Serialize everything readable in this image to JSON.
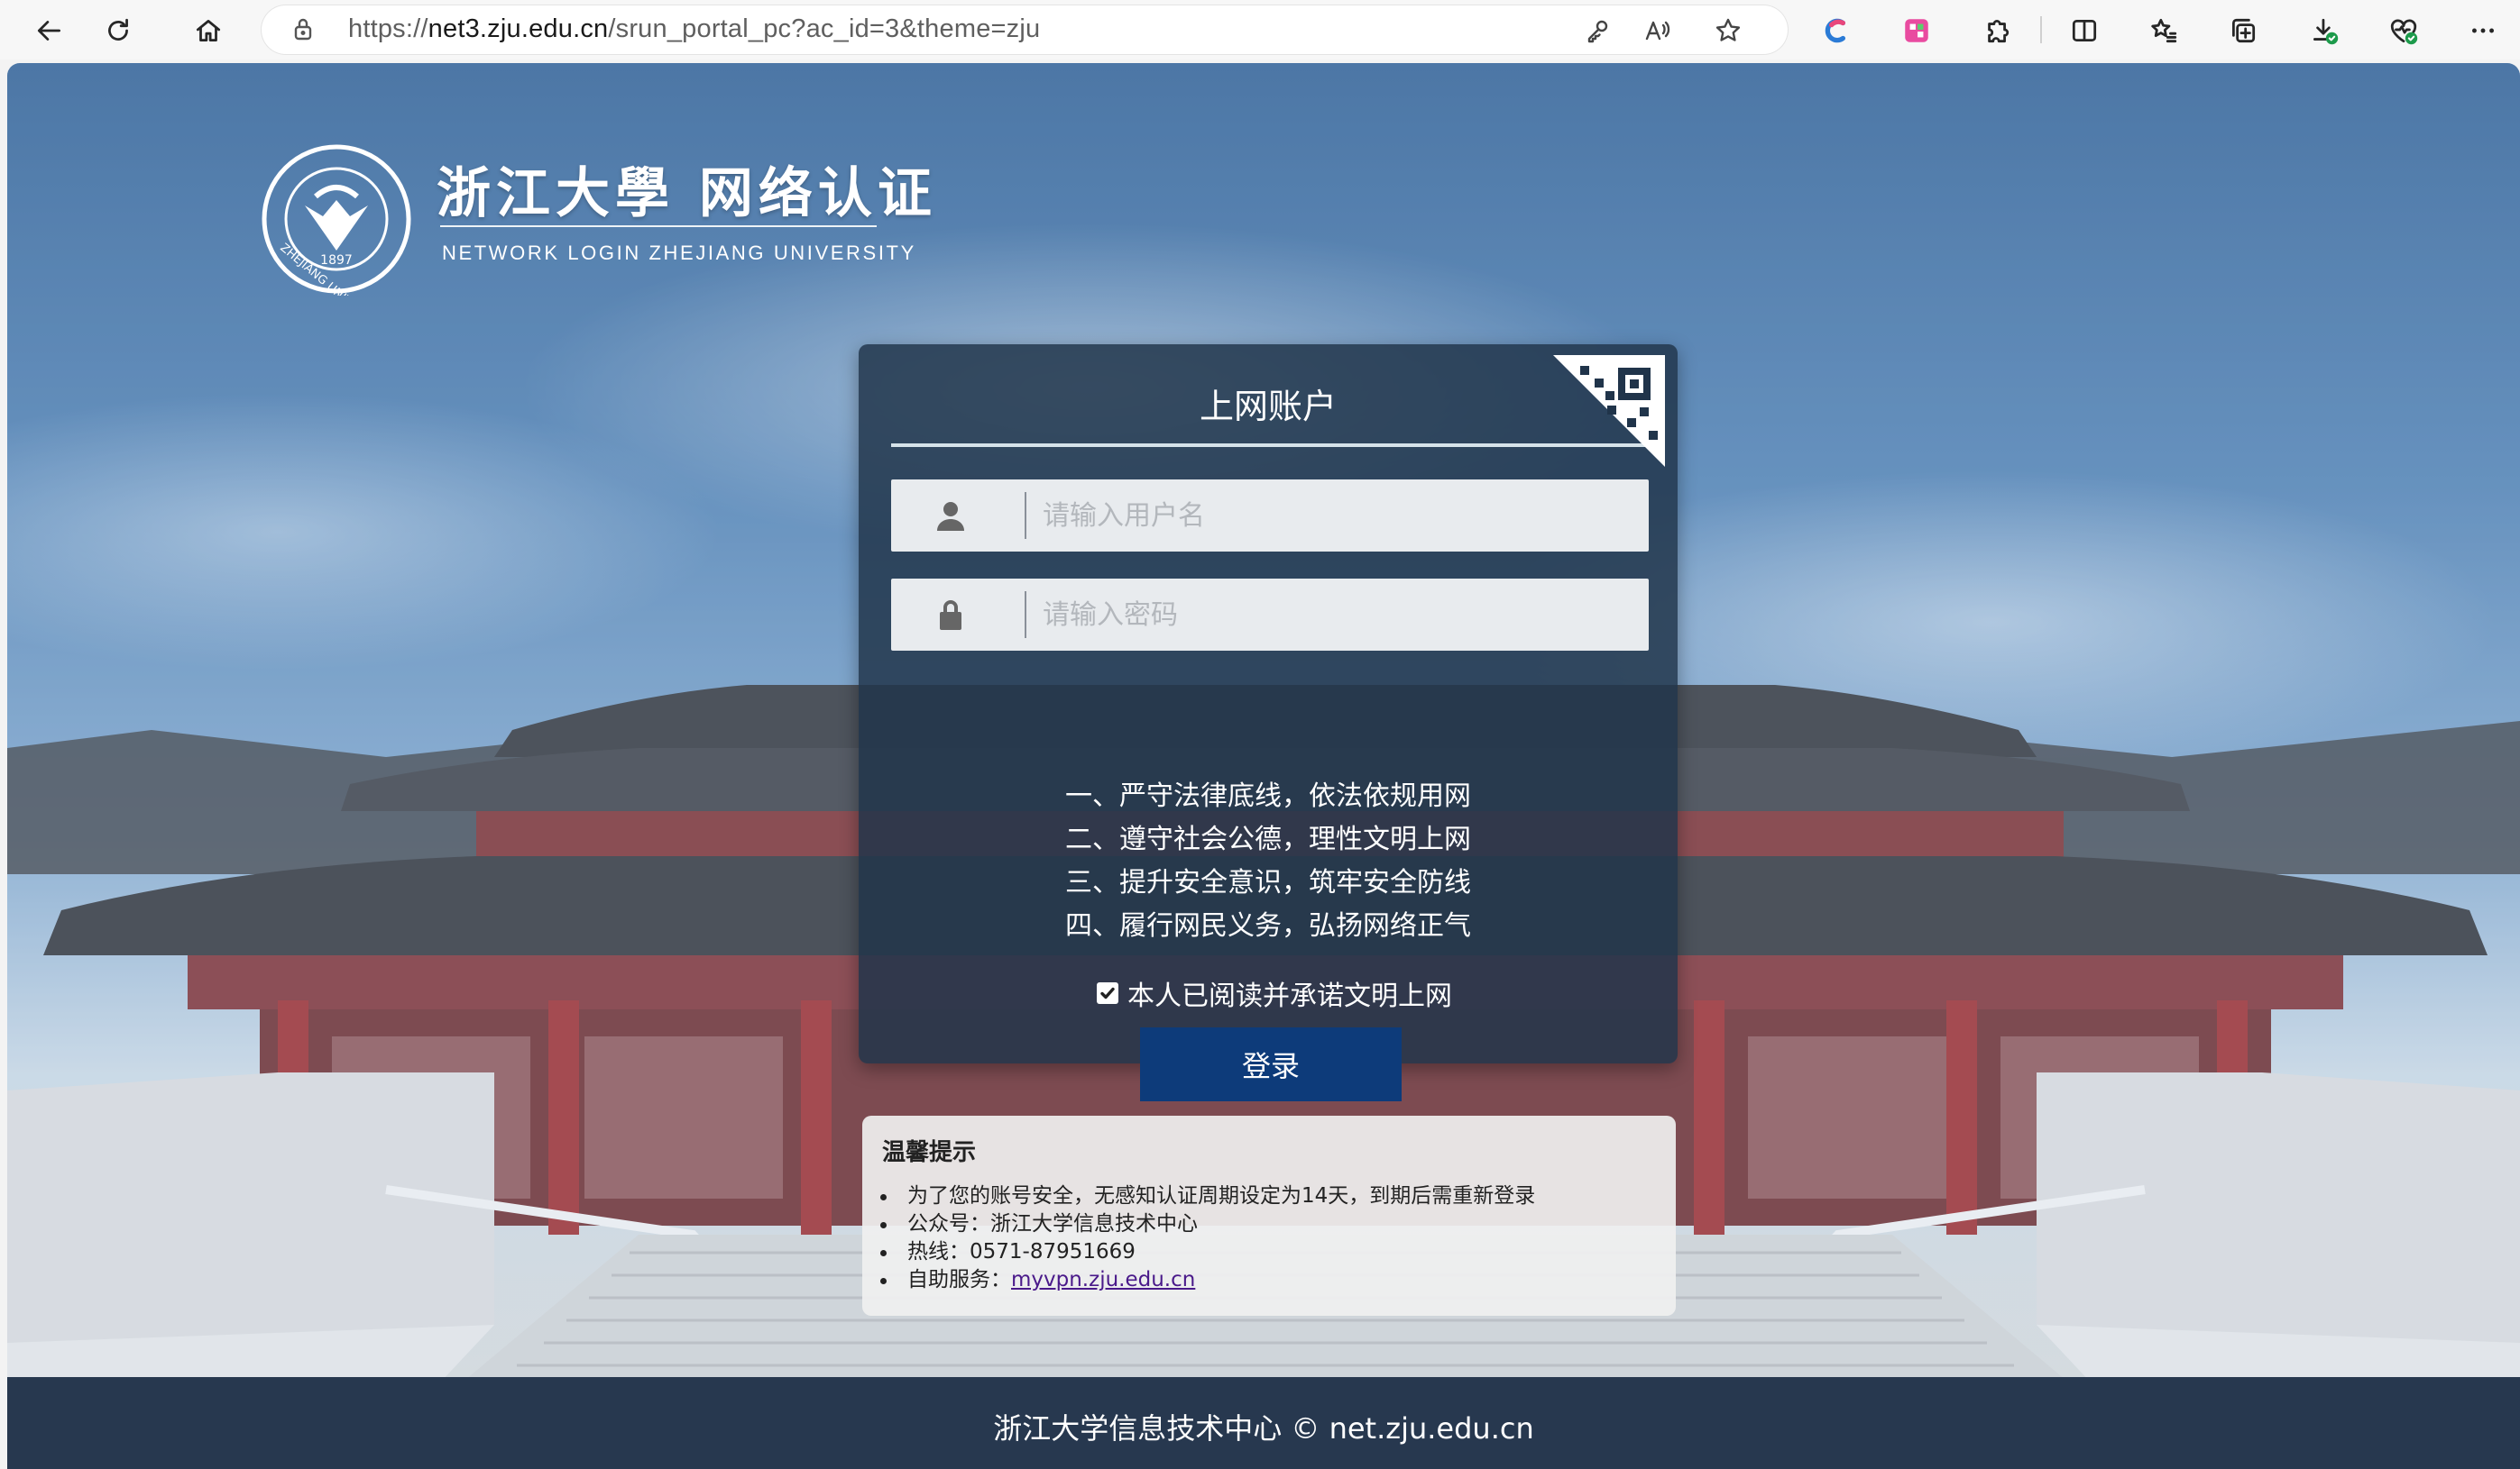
{
  "browser": {
    "url_prefix": "https://",
    "url_host": "net3.zju.edu.cn",
    "url_path": "/srun_portal_pc?ac_id=3&theme=zju",
    "icons": [
      "back-icon",
      "refresh-icon",
      "home-icon",
      "site-info-icon",
      "password-key-icon",
      "read-aloud-icon",
      "favorite-star-icon",
      "copilot-icon",
      "extension-icon",
      "puzzle-icon",
      "split-screen-icon",
      "favorites-icon",
      "collections-icon",
      "downloads-icon",
      "browser-essentials-icon",
      "more-icon"
    ]
  },
  "logo": {
    "title": "浙江大學 网络认证",
    "subtitle": "NETWORK LOGIN ZHEJIANG UNIVERSITY"
  },
  "login": {
    "title": "上网账户",
    "username_placeholder": "请输入用户名",
    "password_placeholder": "请输入密码",
    "rules": [
      "一、严守法律底线，依法依规用网",
      "二、遵守社会公德，理性文明上网",
      "三、提升安全意识，筑牢安全防线",
      "四、履行网民义务，弘扬网络正气"
    ],
    "agree_label": "本人已阅读并承诺文明上网",
    "agree_checked": true,
    "login_label": "登录"
  },
  "notice": {
    "title": "温馨提示",
    "items": [
      "为了您的账号安全，无感知认证周期设定为14天，到期后需重新登录",
      "公众号：浙江大学信息技术中心",
      "热线：0571-87951669"
    ],
    "self_service_label": "自助服务：",
    "self_service_link": "myvpn.zju.edu.cn"
  },
  "footer": {
    "text": "浙江大学信息技术中心 © net.zju.edu.cn"
  }
}
